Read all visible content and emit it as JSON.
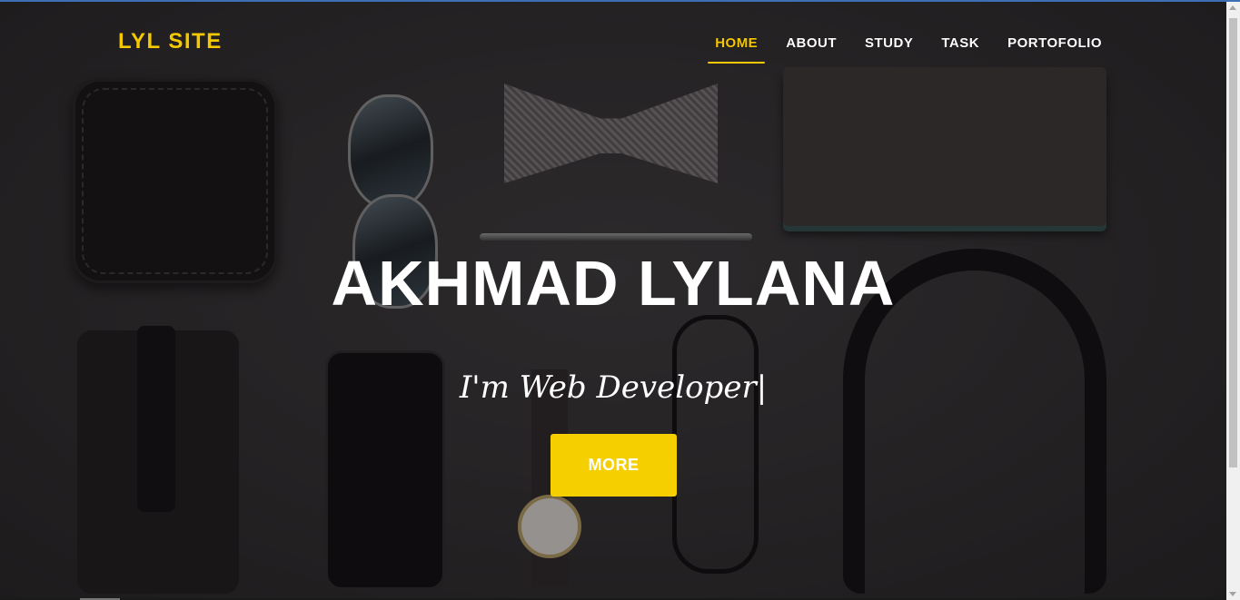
{
  "site": {
    "logo": "LYL SITE"
  },
  "nav": {
    "items": [
      {
        "label": "HOME",
        "active": true
      },
      {
        "label": "ABOUT",
        "active": false
      },
      {
        "label": "STUDY",
        "active": false
      },
      {
        "label": "TASK",
        "active": false
      },
      {
        "label": "PORTOFOLIO",
        "active": false
      }
    ]
  },
  "hero": {
    "title": "AKHMAD LYLANA",
    "subtitle": "I'm Web Developer",
    "cursor": "|",
    "button_label": "MORE"
  },
  "colors": {
    "accent": "#f5c800",
    "button": "#f5cf00",
    "text": "#ffffff",
    "background": "#2d2b2c"
  }
}
